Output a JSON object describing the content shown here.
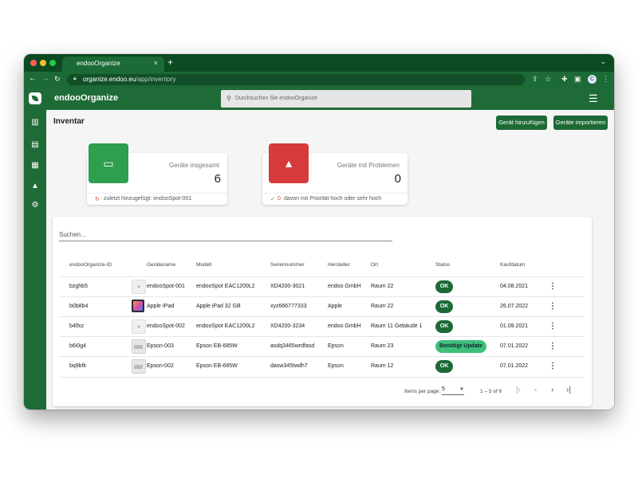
{
  "browser": {
    "tab_title": "endooOrganize",
    "tab_close": "×",
    "new_tab": "+",
    "url_host": "organize.endoo.eu",
    "url_path": "/app/inventory",
    "back": "←",
    "forward": "→",
    "reload": "C",
    "profile_initial": "C",
    "colors": {
      "close": "#ff5f57",
      "minimize": "#febc2e",
      "zoom": "#28c840"
    }
  },
  "app": {
    "brand": "endooOrganize",
    "search_placeholder": "Durchsuchen Sie endooOrganize",
    "accent": "#1f6b37"
  },
  "page": {
    "title": "Inventar",
    "add_button": "Gerät hinzufügen",
    "import_button": "Geräte importieren"
  },
  "cards": {
    "total": {
      "label": "Geräte insgesamt",
      "value": "6",
      "footer": "zuletzt hinzugefügt: endooSpot-001",
      "color": "#2e9e4f"
    },
    "problems": {
      "label": "Geräte mit Problemen",
      "value": "0",
      "footer_count": "0",
      "footer": "davon mit Priorität hoch oder sehr hoch",
      "color": "#d63a3a"
    }
  },
  "table": {
    "search_placeholder": "Suchen...",
    "columns": [
      "endooOrganize-ID",
      "Gerätename",
      "Modell",
      "Seriennummer",
      "Hersteller",
      "Ort",
      "Status",
      "Kaufdatum"
    ],
    "rows": [
      {
        "id": "bzghb5",
        "name": "endooSpot-001",
        "model": "endooSpot EAC1200L2",
        "serial": "XD4200-3021",
        "maker": "endoo GmbH",
        "location": "Raum 22",
        "status": "OK",
        "date": "04.08.2021",
        "thumb": "sensor"
      },
      {
        "id": "b0b8b4",
        "name": "Apple IPad",
        "model": "Apple iPad 32 GB",
        "serial": "xyz666777333",
        "maker": "Apple",
        "location": "Raum 22",
        "status": "OK",
        "date": "26.07.2022",
        "thumb": "ipad"
      },
      {
        "id": "b4lfxz",
        "name": "endooSpot-002",
        "model": "endooSpot EAC1200L2",
        "serial": "XD4200-3234",
        "maker": "endoo GmbH",
        "location": "Raum 11 Gebäude 1",
        "status": "OK",
        "date": "01.09.2021",
        "thumb": "sensor"
      },
      {
        "id": "b6i0g4",
        "name": "Epson-003",
        "model": "Epson EB-685W",
        "serial": "asdq3465wrdfasd",
        "maker": "Epson",
        "location": "Raum 23",
        "status": "Benötigt Update",
        "date": "07.01.2022",
        "thumb": "beamer"
      },
      {
        "id": "bq9bfk",
        "name": "Epson-002",
        "model": "Epson EB-685W",
        "serial": "dasw345twdh7",
        "maker": "Epson",
        "location": "Raum 12",
        "status": "OK",
        "date": "07.01.2022",
        "thumb": "beamer"
      }
    ],
    "pagination": {
      "items_per_page_label": "Items per page:",
      "items_per_page": "5",
      "range": "1 – 5 of 6",
      "first": "|‹",
      "prev": "‹",
      "next": "›",
      "last": "›|"
    }
  }
}
